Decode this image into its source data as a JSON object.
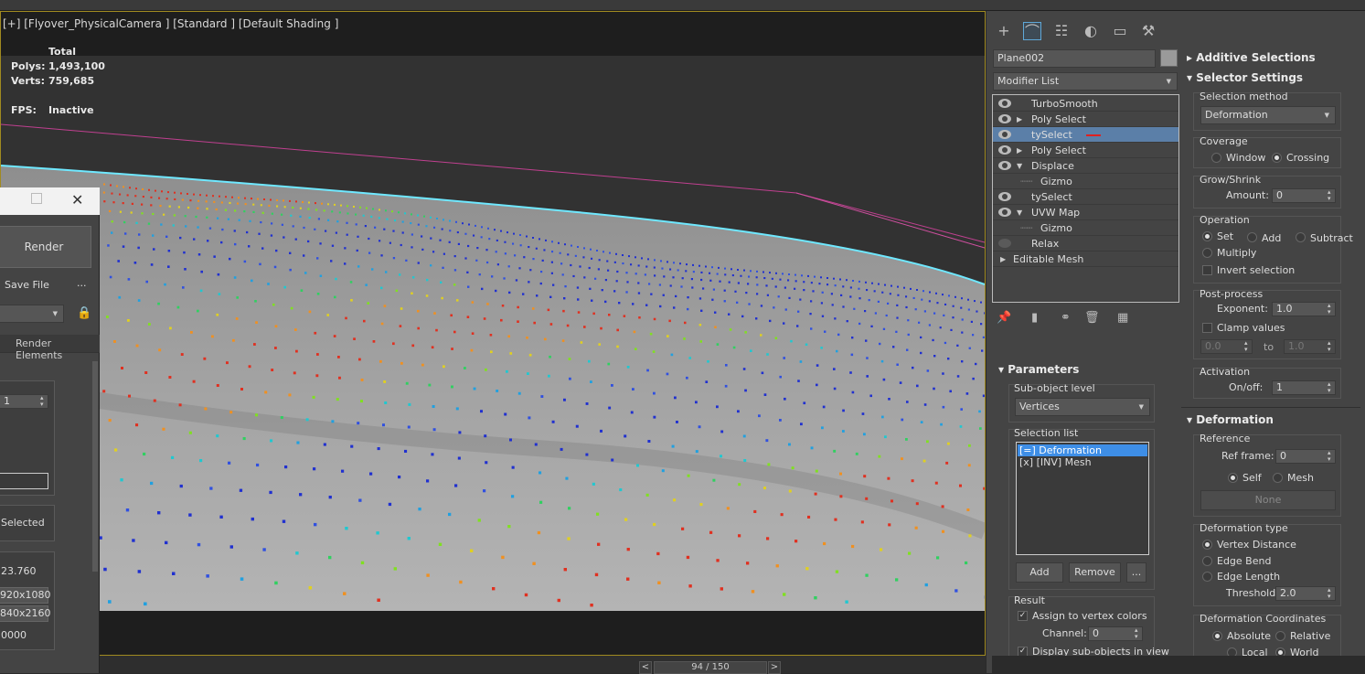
{
  "viewport": {
    "label": "[+] [Flyover_PhysicalCamera ] [Standard ] [Default Shading ]",
    "stats": {
      "header": "Total",
      "polys_label": "Polys:",
      "polys_value": "1,493,100",
      "verts_label": "Verts:",
      "verts_value": "759,685",
      "fps_label": "FPS:",
      "fps_value": "Inactive"
    }
  },
  "timeline": {
    "prev": "<",
    "frame": "94 / 150",
    "next": ">"
  },
  "render_window": {
    "render_button": "Render",
    "save_file": "Save File",
    "more": "...",
    "render_elements_tab": "Render Elements",
    "spinner_value": "1",
    "selected_label": "Selected",
    "value_1": "23.760",
    "res_1": "920x1080",
    "res_2": "840x2160",
    "value_2": "0000"
  },
  "command_panel": {
    "tabs": [
      "create-icon",
      "modify-icon",
      "hierarchy-icon",
      "motion-icon",
      "display-icon",
      "utilities-icon"
    ],
    "object_name": "Plane002",
    "object_color": "#9a9a9a",
    "modifier_list": "Modifier List",
    "stack": [
      {
        "label": "TurboSmooth",
        "eye": true,
        "arrow": "",
        "indent": 0
      },
      {
        "label": "Poly Select",
        "eye": true,
        "arrow": "▶",
        "indent": 0
      },
      {
        "label": "tySelect",
        "eye": true,
        "arrow": "",
        "indent": 0,
        "selected": true
      },
      {
        "label": "Poly Select",
        "eye": true,
        "arrow": "▶",
        "indent": 0
      },
      {
        "label": "Displace",
        "eye": true,
        "arrow": "▼",
        "indent": 0
      },
      {
        "label": "Gizmo",
        "eye": false,
        "arrow": "",
        "indent": 1
      },
      {
        "label": "tySelect",
        "eye": true,
        "arrow": "",
        "indent": 0
      },
      {
        "label": "UVW Map",
        "eye": true,
        "arrow": "▼",
        "indent": 0
      },
      {
        "label": "Gizmo",
        "eye": false,
        "arrow": "",
        "indent": 1
      },
      {
        "label": "Relax",
        "eye": "off",
        "arrow": "",
        "indent": 0
      },
      {
        "label": "Editable Mesh",
        "eye": false,
        "arrow": "▶",
        "indent": -1
      }
    ],
    "parameters": {
      "title": "Parameters",
      "subobject_label": "Sub-object level",
      "subobject_value": "Vertices",
      "selection_list_label": "Selection list",
      "selection_items": [
        "[=]  Deformation",
        "[x]  [INV] Mesh"
      ],
      "add_button": "Add",
      "remove_button": "Remove",
      "more_button": "...",
      "result_label": "Result",
      "assign_vc": "Assign to vertex colors",
      "channel_label": "Channel:",
      "channel_value": "0",
      "display_sub": "Display sub-objects in view"
    },
    "additive": {
      "title": "Additive Selections"
    },
    "selector": {
      "title": "Selector Settings",
      "method_label": "Selection method",
      "method_value": "Deformation",
      "coverage_label": "Coverage",
      "window": "Window",
      "crossing": "Crossing",
      "grow_label": "Grow/Shrink",
      "amount_label": "Amount:",
      "amount_value": "0",
      "operation_label": "Operation",
      "set": "Set",
      "add": "Add",
      "subtract": "Subtract",
      "multiply": "Multiply",
      "invert": "Invert selection",
      "post_label": "Post-process",
      "exponent_label": "Exponent:",
      "exponent_value": "1.0",
      "clamp": "Clamp values",
      "clamp_min": "0.0",
      "clamp_to": "to",
      "clamp_max": "1.0",
      "activation_label": "Activation",
      "onoff_label": "On/off:",
      "onoff_value": "1"
    },
    "deformation": {
      "title": "Deformation",
      "reference_label": "Reference",
      "ref_frame_label": "Ref frame:",
      "ref_frame_value": "0",
      "self": "Self",
      "mesh": "Mesh",
      "none_button": "None",
      "type_label": "Deformation type",
      "vertex_distance": "Vertex Distance",
      "edge_bend": "Edge Bend",
      "edge_length": "Edge Length",
      "threshold_label": "Threshold:",
      "threshold_value": "2.0",
      "coords_label": "Deformation Coordinates",
      "absolute": "Absolute",
      "relative": "Relative",
      "local": "Local",
      "world": "World"
    }
  }
}
